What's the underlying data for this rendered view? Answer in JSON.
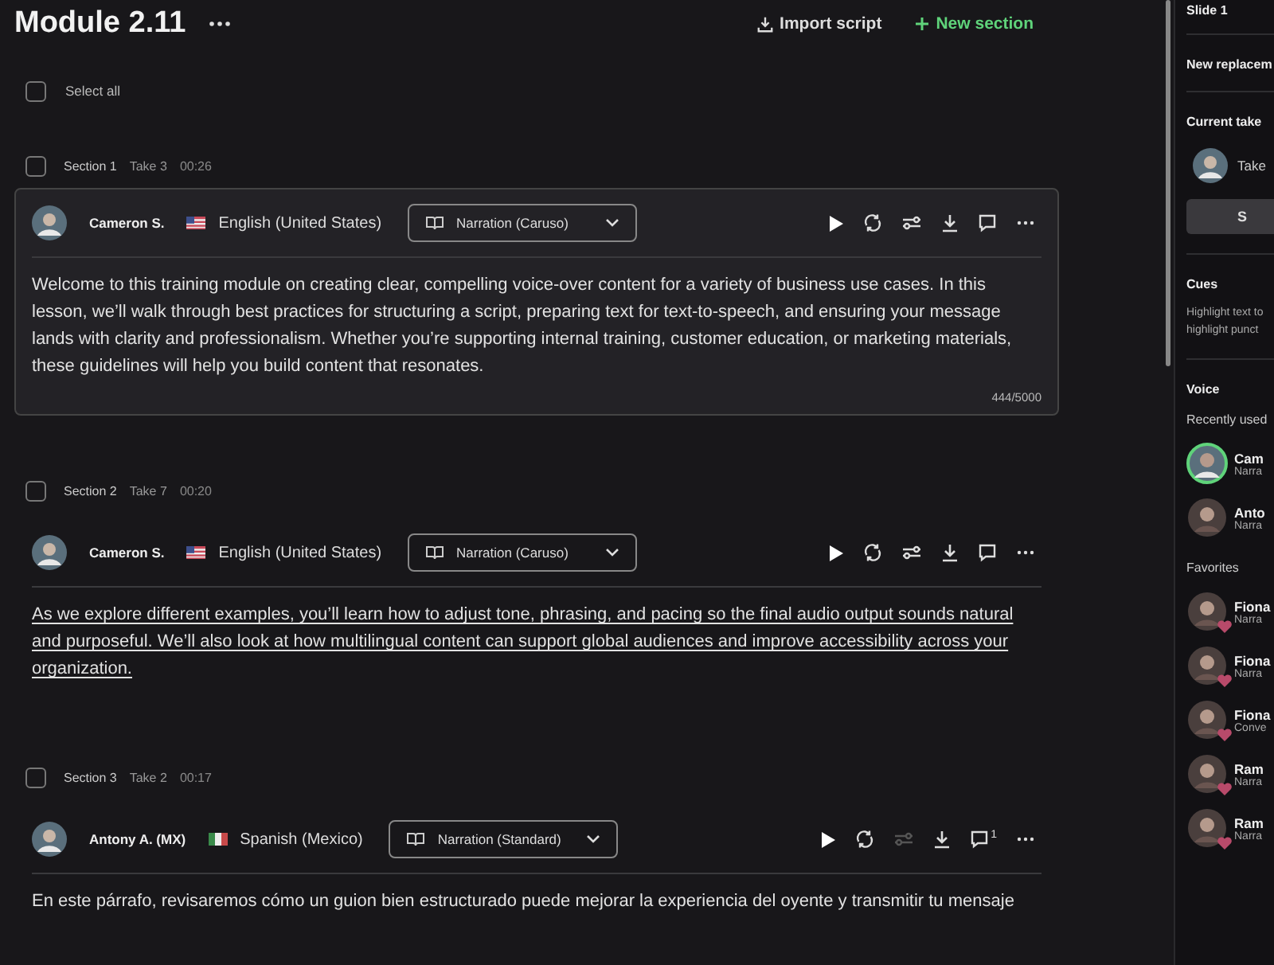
{
  "header": {
    "title": "Module 2.11",
    "import_label": "Import script",
    "new_section_label": "New section"
  },
  "select_all": {
    "label": "Select all",
    "checked": false
  },
  "sections": [
    {
      "name": "Section 1",
      "take": "Take 3",
      "duration": "00:26",
      "checked": false,
      "active": true,
      "speaker": "Cameron S.",
      "flag": {
        "kind": "us"
      },
      "language": "English (United States)",
      "style": "Narration (Caruso)",
      "adjust_disabled": false,
      "underlined": false,
      "text": "Welcome to this training module on creating clear, compelling voice-over content for a variety of business use cases. In this lesson, we’ll walk through best practices for structuring a script, preparing text for text-to-speech, and ensuring your message lands with clarity and professionalism. Whether you’re supporting internal training, customer education, or marketing materials, these guidelines will help you build content that resonates.",
      "char_count": "444/5000"
    },
    {
      "name": "Section 2",
      "take": "Take 7",
      "duration": "00:20",
      "checked": false,
      "active": false,
      "speaker": "Cameron S.",
      "flag": {
        "kind": "us"
      },
      "language": "English (United States)",
      "style": "Narration (Caruso)",
      "adjust_disabled": false,
      "underlined": true,
      "text": "As we explore different examples, you’ll learn how to adjust tone, phrasing, and pacing so the final audio output sounds natural and purposeful. We’ll also look at how multilingual content can support global audiences and improve accessibility across your organization."
    },
    {
      "name": "Section 3",
      "take": "Take 2",
      "duration": "00:17",
      "checked": false,
      "active": false,
      "speaker": "Antony A. (MX)",
      "flag": {
        "kind": "mx"
      },
      "language": "Spanish (Mexico)",
      "style": "Narration (Standard)",
      "adjust_disabled": true,
      "underlined": false,
      "comment_count": "1",
      "text": "En este párrafo, revisaremos cómo un guion bien estructurado puede mejorar la experiencia del oyente y transmitir tu mensaje"
    }
  ],
  "side_panel": {
    "slide": "Slide 1",
    "replacement": "New replacem",
    "current_take": {
      "heading": "Current take",
      "label": "Take",
      "button": "S"
    },
    "cues": {
      "heading": "Cues",
      "lines": [
        "Highlight text to",
        "highlight punct"
      ]
    },
    "voice": {
      "heading": "Voice",
      "groups": [
        {
          "label": "Recently used",
          "voices": [
            {
              "name": "Cam",
              "style": "Narra",
              "selected": true,
              "favorite": false
            },
            {
              "name": "Anto",
              "style": "Narra",
              "selected": false,
              "favorite": false
            }
          ]
        },
        {
          "label": "Favorites",
          "voices": [
            {
              "name": "Fiona",
              "style": "Narra",
              "selected": false,
              "favorite": true
            },
            {
              "name": "Fiona",
              "style": "Narra",
              "selected": false,
              "favorite": true
            },
            {
              "name": "Fiona",
              "style": "Conve",
              "selected": false,
              "favorite": true
            },
            {
              "name": "Ram",
              "style": "Narra",
              "selected": false,
              "favorite": true
            },
            {
              "name": "Ram",
              "style": "Narra",
              "selected": false,
              "favorite": true
            }
          ]
        }
      ]
    }
  }
}
